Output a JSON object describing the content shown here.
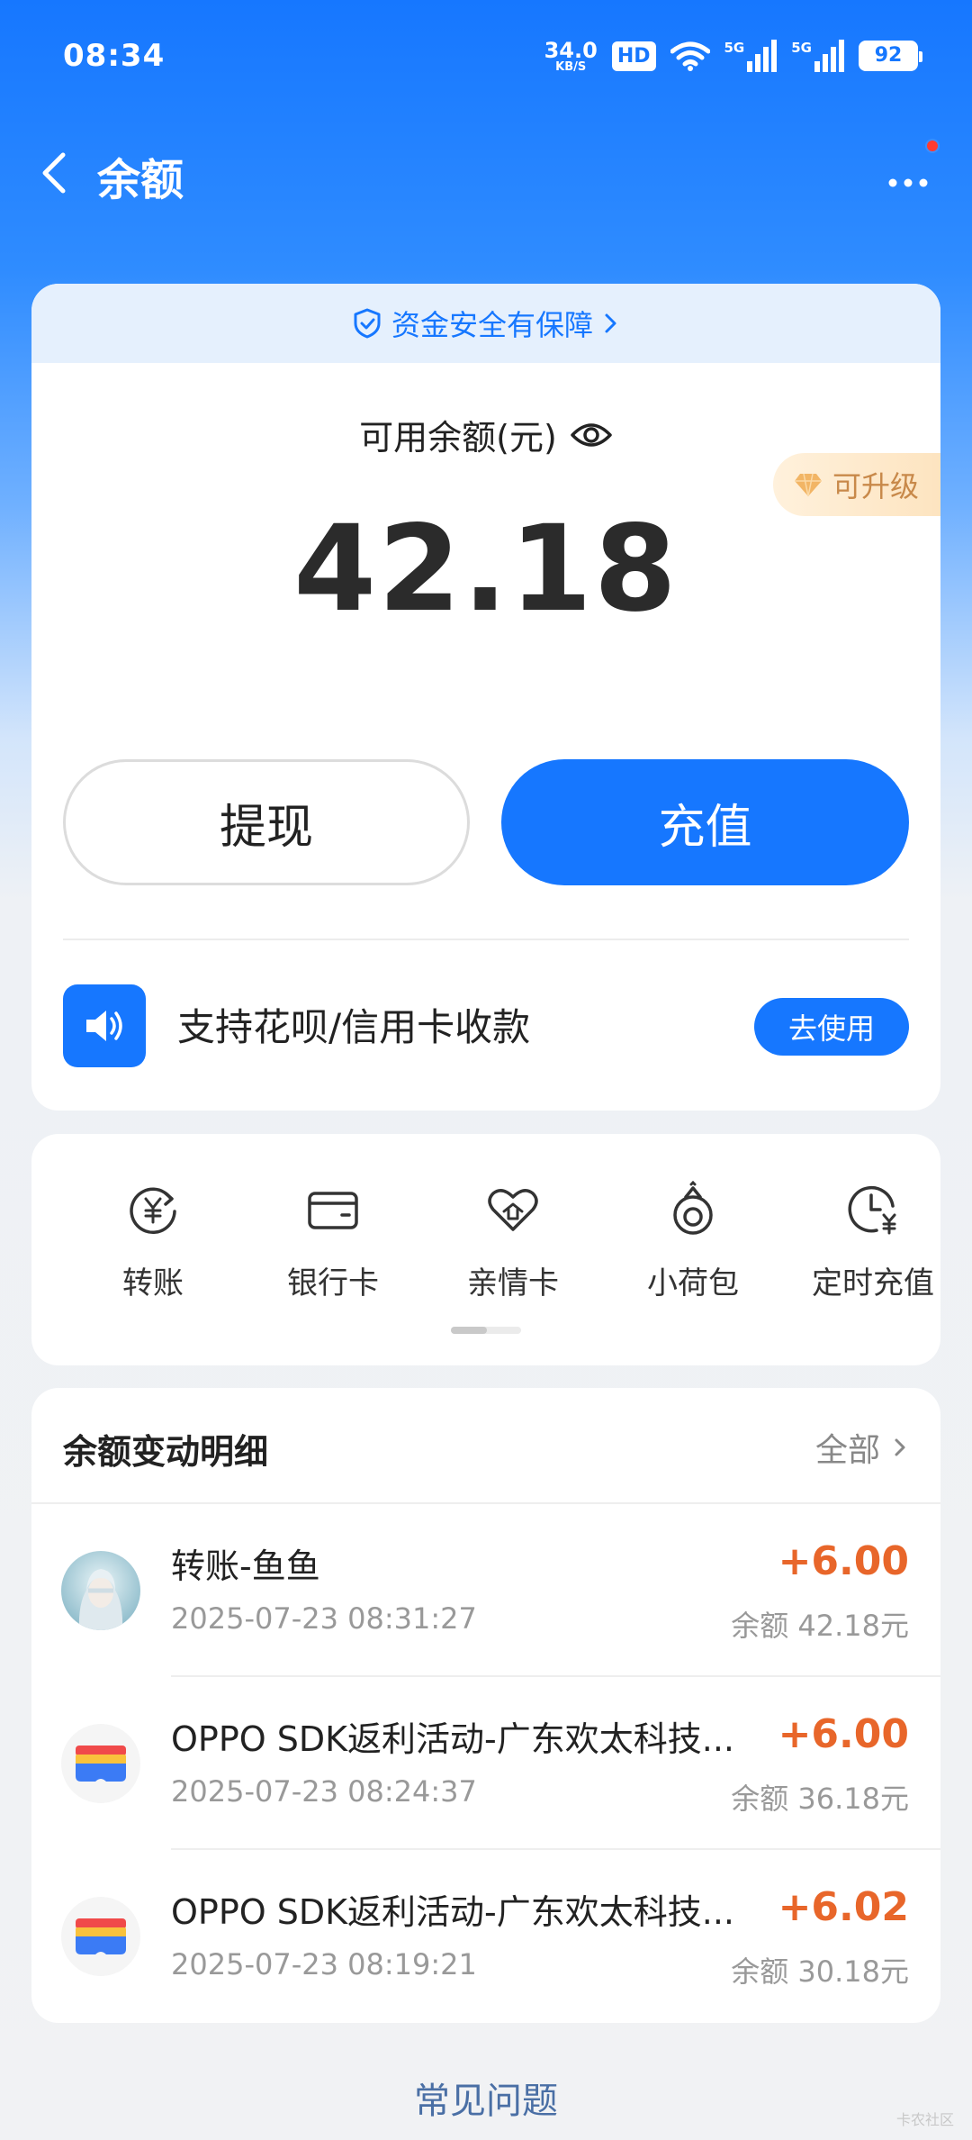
{
  "status_bar": {
    "time": "08:34",
    "net_speed_value": "34.0",
    "net_speed_unit": "KB/S",
    "hd_label": "HD",
    "signal_1_label": "5G",
    "signal_2_label": "5G",
    "battery": "92"
  },
  "header": {
    "title": "余额",
    "back_icon": "chevron-left-icon",
    "more_icon": "more-horizontal-icon",
    "has_notification_dot": true
  },
  "balance_card": {
    "safety_text": "资金安全有保障",
    "balance_label": "可用余额(元)",
    "balance_amount": "42.18",
    "upgrade_badge": "可升级",
    "withdraw_label": "提现",
    "recharge_label": "充值",
    "promo_text": "支持花呗/信用卡收款",
    "promo_button": "去使用"
  },
  "tools": [
    {
      "label": "转账",
      "icon": "transfer-yuan-icon"
    },
    {
      "label": "银行卡",
      "icon": "bank-card-icon"
    },
    {
      "label": "亲情卡",
      "icon": "family-card-icon"
    },
    {
      "label": "小荷包",
      "icon": "small-pouch-icon"
    },
    {
      "label": "定时充值",
      "icon": "scheduled-recharge-icon"
    }
  ],
  "records": {
    "heading": "余额变动明细",
    "all_label": "全部",
    "items": [
      {
        "title": "转账-鱼鱼",
        "time": "2025-07-23 08:31:27",
        "amount": "+6.00",
        "balance": "余额 42.18元",
        "avatar": "user-avatar"
      },
      {
        "title": "OPPO SDK返利活动-广东欢太科技...",
        "time": "2025-07-23 08:24:37",
        "amount": "+6.00",
        "balance": "余额 36.18元",
        "avatar": "wallet-logo"
      },
      {
        "title": "OPPO SDK返利活动-广东欢太科技...",
        "time": "2025-07-23 08:19:21",
        "amount": "+6.02",
        "balance": "余额 30.18元",
        "avatar": "wallet-logo"
      }
    ]
  },
  "footer": {
    "faq_label": "常见问题",
    "watermark": "卡农社区"
  },
  "colors": {
    "primary": "#1677ff",
    "amount_positive": "#e8662a",
    "upgrade_gold": "#c8894a"
  }
}
